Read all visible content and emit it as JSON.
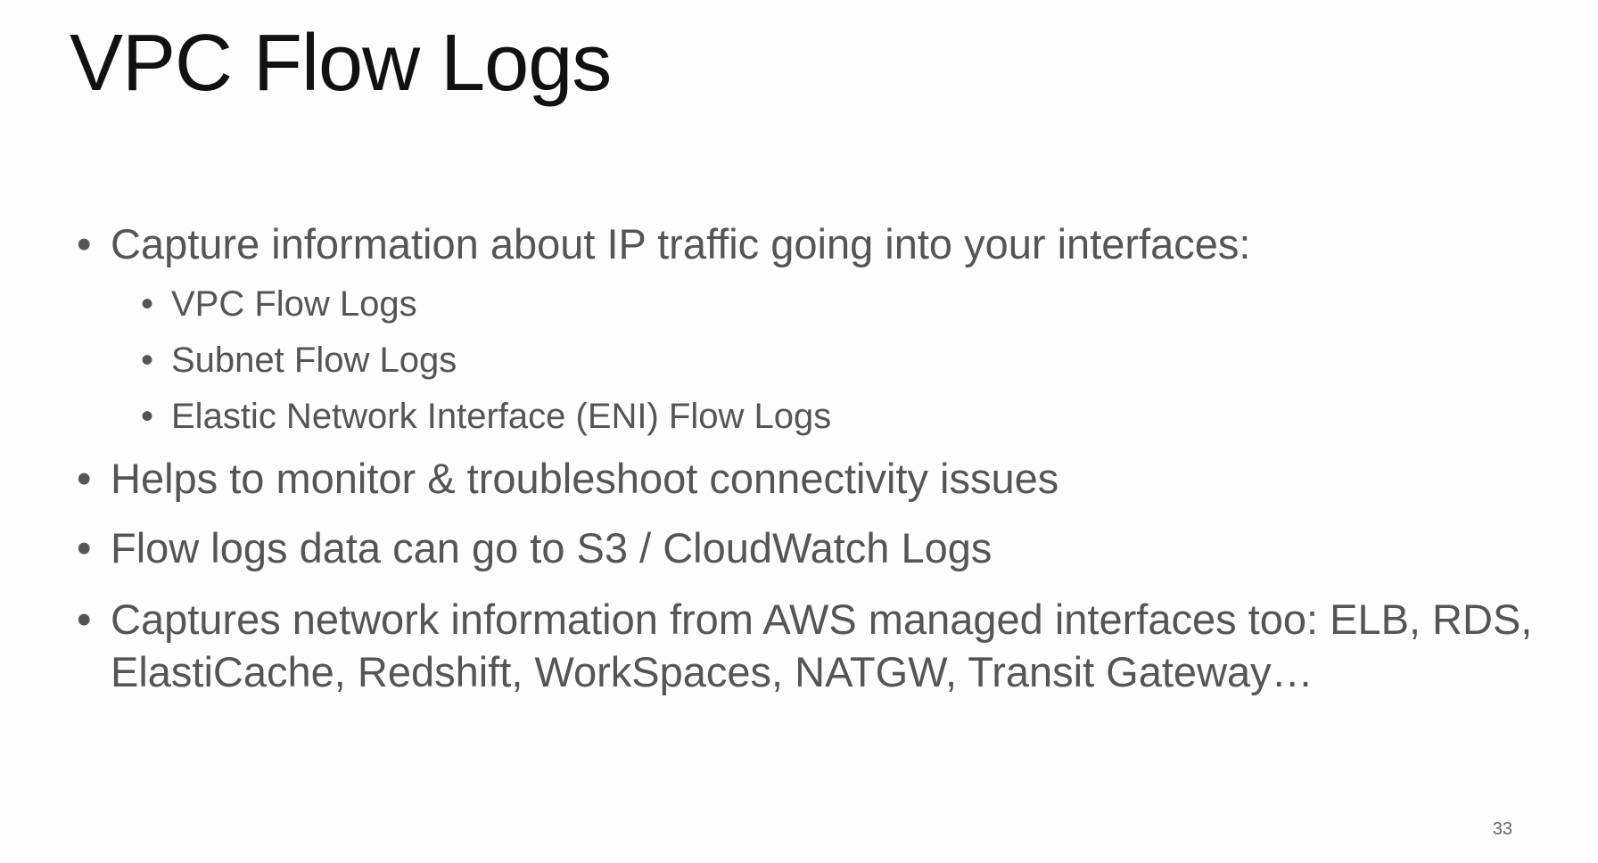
{
  "slide": {
    "title": "VPC Flow Logs",
    "bullets": [
      {
        "text": "Capture information about IP traffic going into your interfaces:",
        "sub": [
          "VPC Flow Logs",
          "Subnet Flow Logs",
          "Elastic Network Interface (ENI) Flow Logs"
        ]
      },
      {
        "text": "Helps to monitor & troubleshoot connectivity issues"
      },
      {
        "text": "Flow logs data can go to S3 / CloudWatch Logs"
      },
      {
        "text": "Captures network information from AWS managed interfaces too: ELB, RDS, ElastiCache, Redshift, WorkSpaces, NATGW, Transit Gateway…"
      }
    ],
    "page_number": "33"
  }
}
